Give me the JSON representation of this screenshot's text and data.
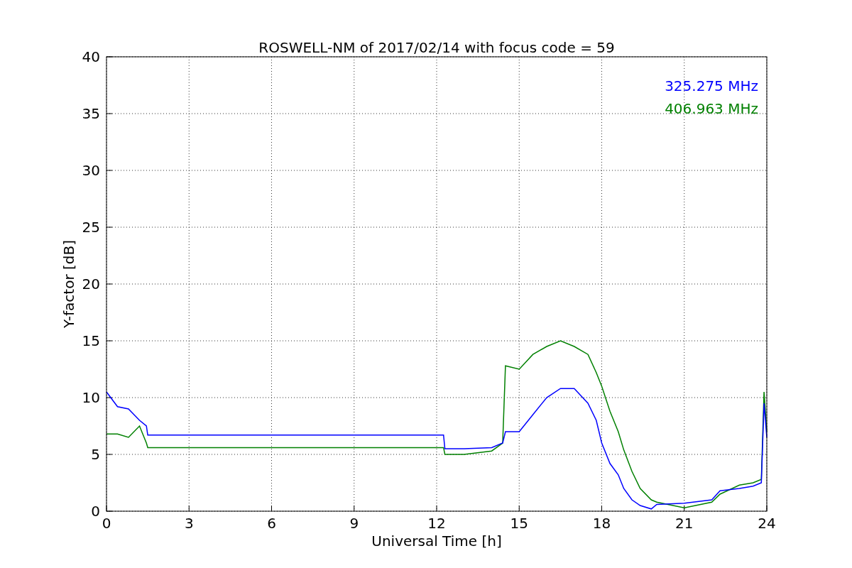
{
  "figure": {
    "chart_data": {
      "type": "line",
      "title": "ROSWELL-NM of 2017/02/14 with focus code = 59",
      "xlabel": "Universal Time [h]",
      "ylabel": "Y-factor [dB]",
      "x": [
        0,
        0.4,
        0.8,
        1.2,
        1.45,
        1.5,
        6,
        12.25,
        12.3,
        13,
        14,
        14.4,
        14.5,
        15,
        15.5,
        16,
        16.5,
        17,
        17.5,
        17.8,
        18,
        18.3,
        18.6,
        18.8,
        19.1,
        19.4,
        19.8,
        20,
        21,
        22,
        22.3,
        23,
        23.5,
        23.8,
        23.9,
        24
      ],
      "series": [
        {
          "name": "325.275 MHz",
          "color": "#0000ff",
          "values": [
            10.5,
            9.2,
            9.0,
            8.0,
            7.5,
            6.7,
            6.7,
            6.7,
            5.5,
            5.5,
            5.6,
            6.0,
            7.0,
            7.0,
            8.5,
            10,
            10.8,
            10.8,
            9.5,
            8.0,
            6.0,
            4.2,
            3.2,
            2.0,
            1.0,
            0.5,
            0.2,
            0.6,
            0.7,
            1.0,
            1.8,
            2.0,
            2.2,
            2.5,
            9.5,
            6.5
          ]
        },
        {
          "name": "406.963 MHz",
          "color": "#008000",
          "values": [
            6.8,
            6.8,
            6.5,
            7.5,
            6.0,
            5.6,
            5.6,
            5.6,
            5.0,
            5.0,
            5.3,
            6.0,
            12.8,
            12.5,
            13.8,
            14.5,
            15.0,
            14.5,
            13.8,
            12.2,
            11.0,
            8.8,
            7.0,
            5.4,
            3.5,
            2.0,
            1.0,
            0.8,
            0.3,
            0.8,
            1.5,
            2.3,
            2.5,
            2.8,
            10.5,
            7.0
          ]
        }
      ],
      "xlim": [
        0,
        24
      ],
      "ylim": [
        0,
        40
      ],
      "xticks": [
        0,
        3,
        6,
        9,
        12,
        15,
        18,
        21,
        24
      ],
      "yticks": [
        0,
        5,
        10,
        15,
        20,
        25,
        30,
        35,
        40
      ],
      "grid": true
    }
  }
}
